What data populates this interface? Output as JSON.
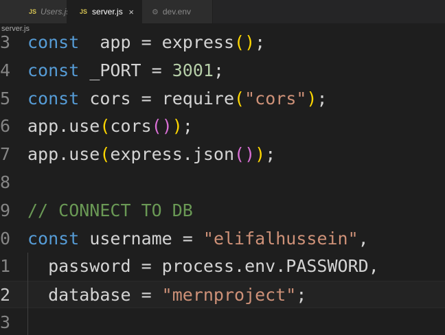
{
  "tabs": [
    {
      "icon": "js-file-icon",
      "badge": "JS",
      "label": "Users.js"
    },
    {
      "icon": "js-file-icon",
      "badge": "JS",
      "label": "server.js",
      "close": "×"
    },
    {
      "icon": "gear-icon",
      "badge": "⚙",
      "label": "dev.env"
    }
  ],
  "breadcrumb": "server.js",
  "lines": [
    {
      "n": "3",
      "tokens": [
        [
          "kw",
          "const"
        ],
        [
          "",
          "  app = express"
        ],
        [
          "p1",
          "()"
        ],
        [
          "",
          ";"
        ]
      ]
    },
    {
      "n": "4",
      "tokens": [
        [
          "kw",
          "const"
        ],
        [
          "",
          " _PORT = "
        ],
        [
          "num",
          "3001"
        ],
        [
          "",
          ";"
        ]
      ]
    },
    {
      "n": "5",
      "tokens": [
        [
          "kw",
          "const"
        ],
        [
          "",
          " cors = require"
        ],
        [
          "p1",
          "("
        ],
        [
          "str",
          "\"cors\""
        ],
        [
          "p1",
          ")"
        ],
        [
          "",
          ";"
        ]
      ]
    },
    {
      "n": "6",
      "tokens": [
        [
          "",
          "app.use"
        ],
        [
          "p1",
          "("
        ],
        [
          "",
          "cors"
        ],
        [
          "p2",
          "()"
        ],
        [
          "p1",
          ")"
        ],
        [
          "",
          ";"
        ]
      ]
    },
    {
      "n": "7",
      "tokens": [
        [
          "",
          "app.use"
        ],
        [
          "p1",
          "("
        ],
        [
          "",
          "express.json"
        ],
        [
          "p2",
          "()"
        ],
        [
          "p1",
          ")"
        ],
        [
          "",
          ";"
        ]
      ]
    },
    {
      "n": "8",
      "tokens": []
    },
    {
      "n": "9",
      "tokens": [
        [
          "cm",
          "// CONNECT TO DB"
        ]
      ]
    },
    {
      "n": "0",
      "tokens": [
        [
          "kw",
          "const"
        ],
        [
          "",
          " username = "
        ],
        [
          "str",
          "\"elifalhussein\""
        ],
        [
          "",
          ","
        ]
      ]
    },
    {
      "n": "1",
      "tokens": [
        [
          "",
          "  password = process.env.PASSWORD,"
        ]
      ]
    },
    {
      "n": "2",
      "tokens": [
        [
          "",
          "  database = "
        ],
        [
          "str",
          "\"mernproject\""
        ],
        [
          "",
          ";"
        ]
      ],
      "active": true
    },
    {
      "n": "3",
      "tokens": []
    }
  ],
  "colors": {
    "keyword": "#569cd6",
    "string": "#ce9178",
    "number": "#b5cea8",
    "comment": "#6a9955",
    "bracket1": "#ffd700",
    "bracket2": "#da70d6"
  }
}
